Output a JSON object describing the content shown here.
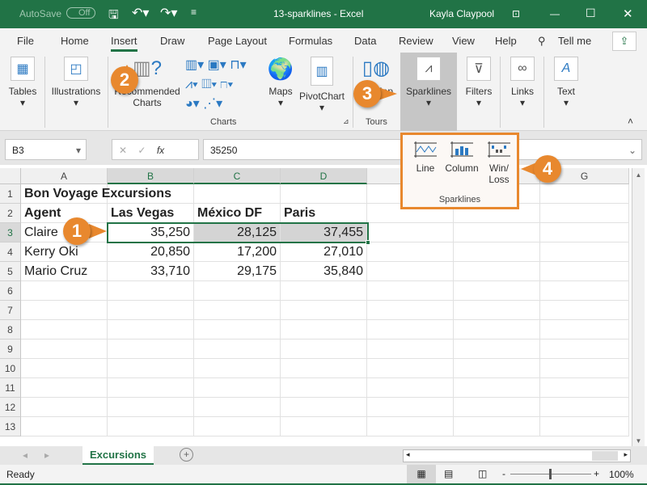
{
  "titlebar": {
    "autosave": "AutoSave",
    "autosave_state": "Off",
    "title": "13-sparklines  -  Excel",
    "user": "Kayla Claypool"
  },
  "tabs": [
    "File",
    "Home",
    "Insert",
    "Draw",
    "Page Layout",
    "Formulas",
    "Data",
    "Review",
    "View",
    "Help",
    "Tell me"
  ],
  "active_tab": "Insert",
  "ribbon": {
    "tables": "Tables",
    "illustrations": "Illustrations",
    "recommended_charts_1": "Recommended",
    "recommended_charts_2": "Charts",
    "maps": "Maps",
    "pivotchart": "PivotChart",
    "map3d": "3D Map",
    "sparklines": "Sparklines",
    "filters": "Filters",
    "links": "Links",
    "text": "Text",
    "group_charts": "Charts",
    "group_tours": "Tours"
  },
  "sparkline_menu": {
    "line": "Line",
    "column": "Column",
    "winloss_1": "Win/",
    "winloss_2": "Loss",
    "group": "Sparklines"
  },
  "formula_bar": {
    "name_box": "B3",
    "fx": "fx",
    "value": "35250"
  },
  "columns": [
    "A",
    "B",
    "C",
    "D",
    "E",
    "F",
    "G"
  ],
  "rows": [
    "1",
    "2",
    "3",
    "4",
    "5",
    "6",
    "7",
    "8",
    "9",
    "10",
    "11",
    "12",
    "13"
  ],
  "cells": {
    "title": "Bon Voyage Excursions",
    "headers": [
      "Agent",
      "Las Vegas",
      "México DF",
      "Paris"
    ],
    "data": [
      [
        "Claire",
        "35,250",
        "28,125",
        "37,455"
      ],
      [
        "Kerry Oki",
        "20,850",
        "17,200",
        "27,010"
      ],
      [
        "Mario Cruz",
        "33,710",
        "29,175",
        "35,840"
      ]
    ]
  },
  "sheet_tab": "Excursions",
  "status": {
    "ready": "Ready",
    "zoom": "100%"
  },
  "callouts": [
    "1",
    "2",
    "3",
    "4"
  ],
  "accent": "#217346",
  "callout_color": "#e8882e"
}
